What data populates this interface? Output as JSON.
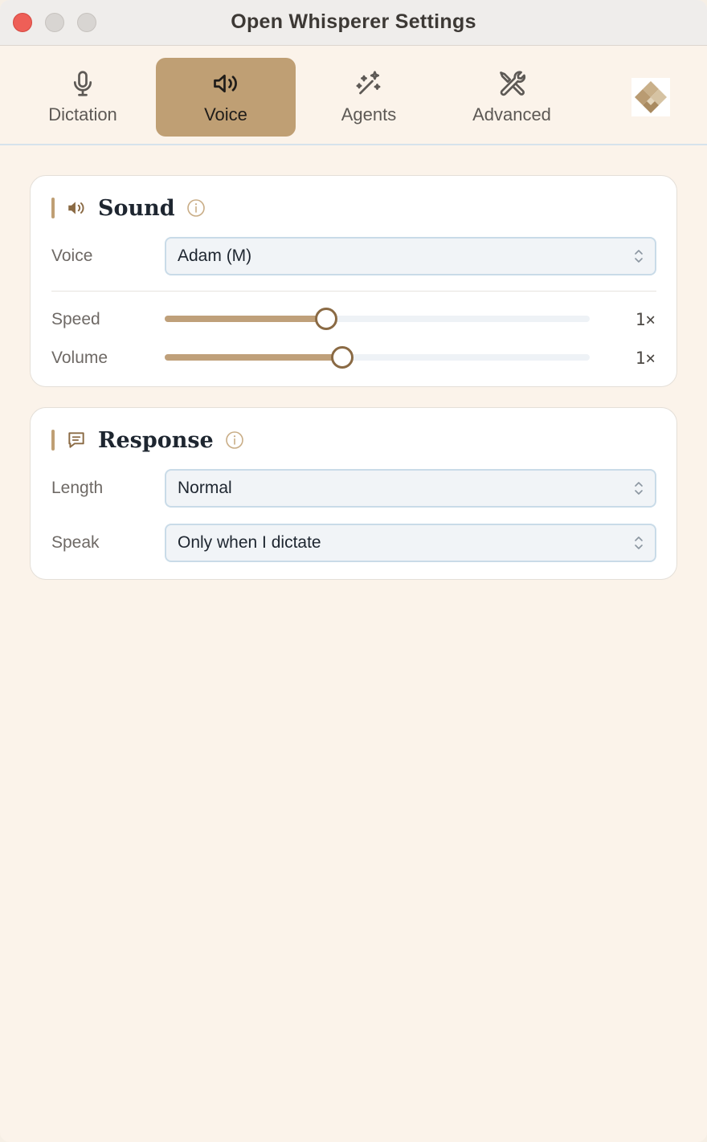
{
  "window": {
    "title": "Open Whisperer Settings"
  },
  "toolbar": {
    "tabs": [
      {
        "label": "Dictation",
        "icon": "microphone-icon",
        "active": false
      },
      {
        "label": "Voice",
        "icon": "speaker-icon",
        "active": true
      },
      {
        "label": "Agents",
        "icon": "magic-wand-icon",
        "active": false
      },
      {
        "label": "Advanced",
        "icon": "tools-icon",
        "active": false
      }
    ],
    "logo": "app-logo-icon"
  },
  "sound": {
    "title": "Sound",
    "voice_label": "Voice",
    "voice_value": "Adam (M)",
    "speed_label": "Speed",
    "speed_value": "1×",
    "speed_fraction": 0.38,
    "volume_label": "Volume",
    "volume_value": "1×",
    "volume_fraction": 0.417
  },
  "response": {
    "title": "Response",
    "length_label": "Length",
    "length_value": "Normal",
    "speak_label": "Speak",
    "speak_value": "Only when I dictate"
  },
  "colors": {
    "accent": "#bf9f74",
    "background": "#fbf3ea",
    "card": "#ffffff",
    "close": "#ee5f57"
  }
}
